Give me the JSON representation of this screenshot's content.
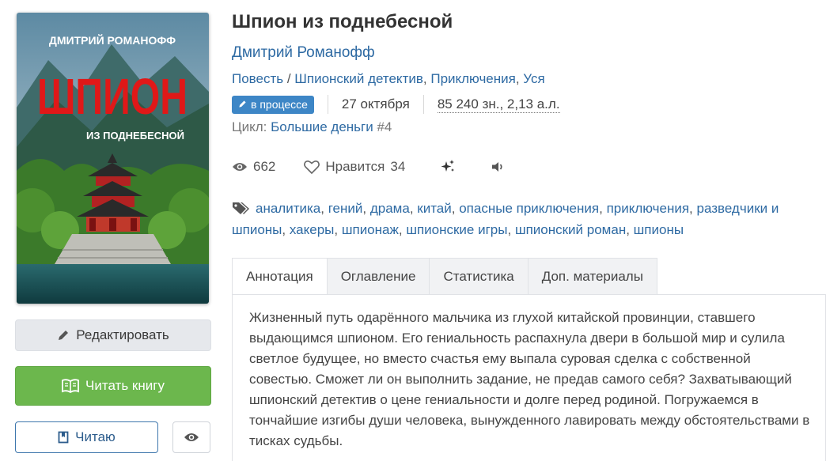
{
  "book": {
    "title": "Шпион из поднебесной",
    "author": "Дмитрий Романофф",
    "genres": [
      {
        "label": "Повесть",
        "sep": " / "
      },
      {
        "label": "Шпионский детектив",
        "sep": ", "
      },
      {
        "label": "Приключения",
        "sep": ", "
      },
      {
        "label": "Уся",
        "sep": ""
      }
    ],
    "status": "в процессе",
    "date": "27 октября",
    "size": "85 240 зн., 2,13 а.л.",
    "cycle_label": "Цикл:",
    "cycle_name": "Большие деньги",
    "cycle_number": "#4"
  },
  "cover": {
    "author": "ДМИТРИЙ РОМАНОФФ",
    "title_big": "ШПИОН",
    "subtitle": "ИЗ ПОДНЕБЕСНОЙ"
  },
  "stats": {
    "views": "662",
    "likes_label": "Нравится",
    "likes": "34"
  },
  "tags": [
    "аналитика",
    "гений",
    "драма",
    "китай",
    "опасные приключения",
    "приключения",
    "разведчики и шпионы",
    "хакеры",
    "шпионаж",
    "шпионские игры",
    "шпионский роман",
    "шпионы"
  ],
  "buttons": {
    "edit": "Редактировать",
    "read": "Читать книгу",
    "reading": "Читаю"
  },
  "tabs": [
    {
      "label": "Аннотация",
      "active": true
    },
    {
      "label": "Оглавление",
      "active": false
    },
    {
      "label": "Статистика",
      "active": false
    },
    {
      "label": "Доп. материалы",
      "active": false
    }
  ],
  "annotation": "Жизненный путь одарённого мальчика из глухой китайской провинции, ставшего выдающимся шпионом. Его гениальность распахнула двери в большой мир и сулила светлое будущее, но вместо счастья ему выпала суровая сделка с собственной совестью. Сможет ли он выполнить задание, не предав самого себя? Захватывающий шпионский детектив о цене гениальности и долге перед родиной. Погружаемся в тончайшие изгибы души человека, вынужденного лавировать между обстоятельствами в тисках судьбы.",
  "colors": {
    "link": "#2e6aa3",
    "badge": "#3d86c6",
    "read_button": "#6cb74d",
    "cover_title": "#e01818"
  }
}
